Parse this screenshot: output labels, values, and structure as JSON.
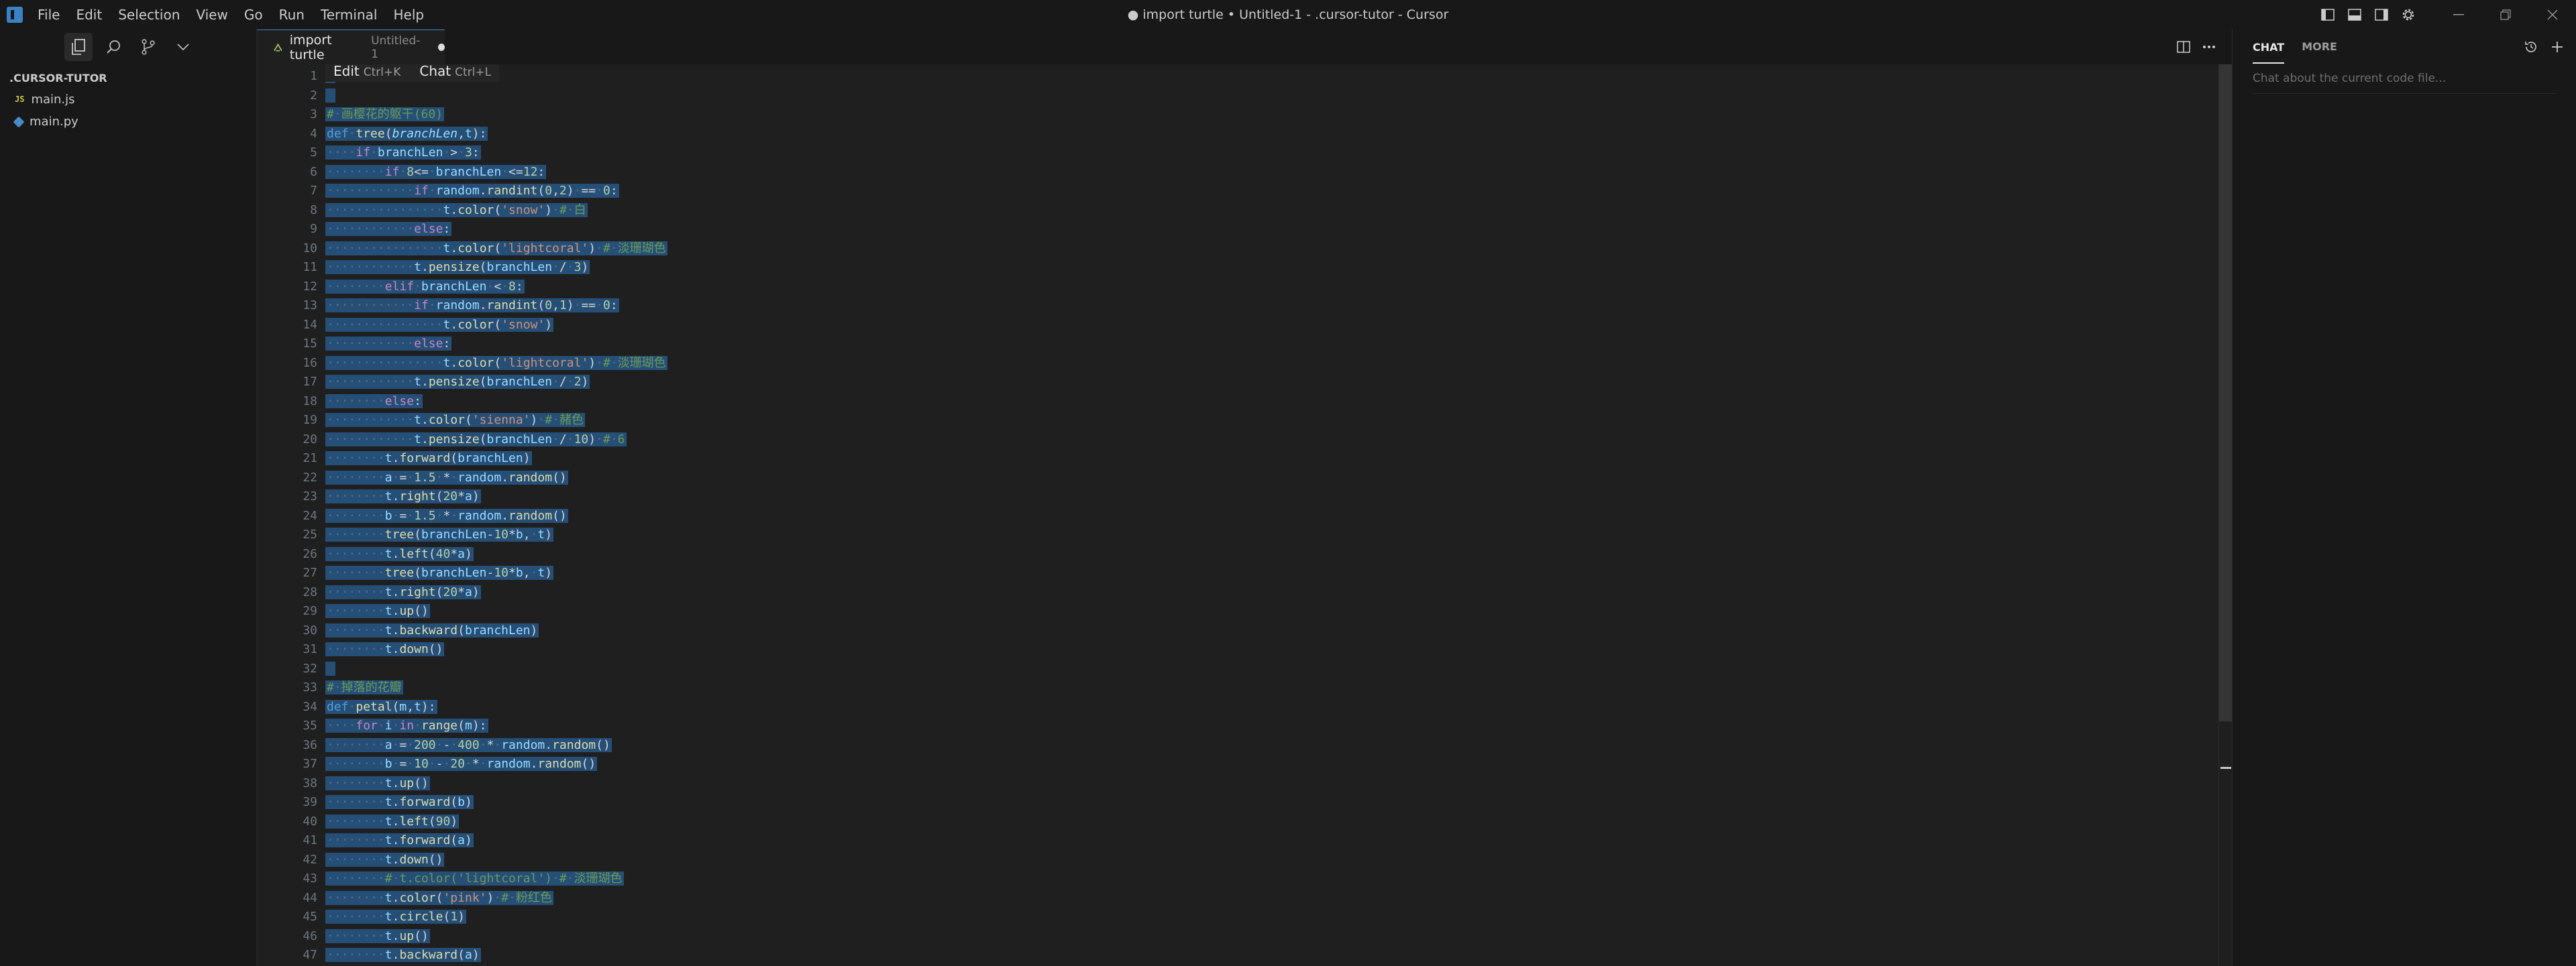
{
  "titlebar": {
    "menu": [
      "File",
      "Edit",
      "Selection",
      "View",
      "Go",
      "Run",
      "Terminal",
      "Help"
    ],
    "window_title": "● import turtle • Untitled-1 - .cursor-tutor - Cursor"
  },
  "sidebar": {
    "explorer_title": ".CURSOR-TUTOR",
    "files": [
      {
        "name": "main.js",
        "type": "js",
        "badge": "JS"
      },
      {
        "name": "main.py",
        "type": "py"
      }
    ]
  },
  "editor": {
    "tab": {
      "title": "import turtle",
      "description": "Untitled-1",
      "modified": true
    },
    "inline_hint": {
      "edit_label": "Edit",
      "edit_shortcut": "Ctrl+K",
      "chat_label": "Chat",
      "chat_shortcut": "Ctrl+L"
    },
    "line_numbers": [
      "1",
      "2",
      "3",
      "4",
      "5",
      "6",
      "7",
      "8",
      "9",
      "10",
      "11",
      "12",
      "13",
      "14",
      "15",
      "16",
      "17",
      "18",
      "19",
      "20",
      "21",
      "22",
      "23",
      "24",
      "25",
      "26",
      "27",
      "28",
      "29",
      "30",
      "31",
      "32",
      "33",
      "34",
      "35",
      "36",
      "37",
      "38",
      "39",
      "40",
      "41",
      "42",
      "43",
      "44",
      "45",
      "46",
      "47"
    ],
    "code_lines": [
      "",
      "",
      "# 画樱花的躯干(60)",
      "def tree(branchLen,t):",
      "    if branchLen > 3:",
      "        if 8<= branchLen <=12:",
      "            if random.randint(0,2) == 0:",
      "                t.color('snow') # 白",
      "            else:",
      "                t.color('lightcoral') # 淡珊瑚色",
      "            t.pensize(branchLen / 3)",
      "        elif branchLen < 8:",
      "            if random.randint(0,1) == 0:",
      "                t.color('snow')",
      "            else:",
      "                t.color('lightcoral') # 淡珊瑚色",
      "            t.pensize(branchLen / 2)",
      "        else:",
      "            t.color('sienna') # 赭色",
      "            t.pensize(branchLen / 10) # 6",
      "        t.forward(branchLen)",
      "        a = 1.5 * random.random()",
      "        t.right(20*a)",
      "        b = 1.5 * random.random()",
      "        tree(branchLen-10*b, t)",
      "        t.left(40*a)",
      "        tree(branchLen-10*b, t)",
      "        t.right(20*a)",
      "        t.up()",
      "        t.backward(branchLen)",
      "        t.down()",
      "",
      "# 掉落的花瓣",
      "def petal(m,t):",
      "    for i in range(m):",
      "        a = 200 - 400 * random.random()",
      "        b = 10 - 20 * random.random()",
      "        t.up()",
      "        t.forward(b)",
      "        t.left(90)",
      "        t.forward(a)",
      "        t.down()",
      "        # t.color('lightcoral') # 淡珊瑚色",
      "        t.color('pink') # 粉红色",
      "        t.circle(1)",
      "        t.up()",
      "        t.backward(a)"
    ]
  },
  "chat": {
    "tabs": [
      "CHAT",
      "MORE"
    ],
    "placeholder": "Chat about the current code file..."
  }
}
